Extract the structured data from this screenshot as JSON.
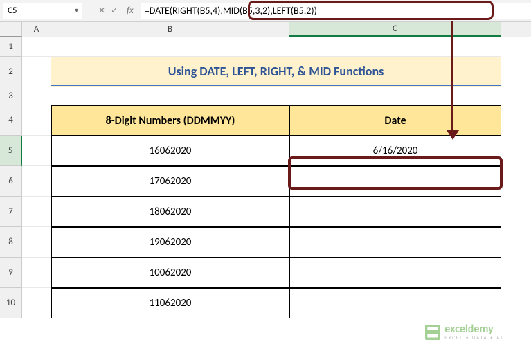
{
  "name_box": "C5",
  "formula": "=DATE(RIGHT(B5,4),MID(B5,3,2),LEFT(B5,2))",
  "fx_label": "fx",
  "columns": [
    "A",
    "B",
    "C"
  ],
  "rows": [
    "1",
    "2",
    "3",
    "4",
    "5",
    "6",
    "7",
    "8",
    "9",
    "10"
  ],
  "title": "Using DATE, LEFT, RIGHT, & MID Functions",
  "headers": {
    "col_b": "8-Digit Numbers (DDMMYY)",
    "col_c": "Date"
  },
  "table_data": [
    {
      "number": "16062020",
      "date": "6/16/2020"
    },
    {
      "number": "17062020",
      "date": ""
    },
    {
      "number": "18062020",
      "date": ""
    },
    {
      "number": "19062020",
      "date": ""
    },
    {
      "number": "10062020",
      "date": ""
    },
    {
      "number": "11062020",
      "date": ""
    }
  ],
  "watermark": {
    "text": "exceldemy",
    "tagline": "EXCEL • DATA • AI"
  },
  "chart_data": null
}
